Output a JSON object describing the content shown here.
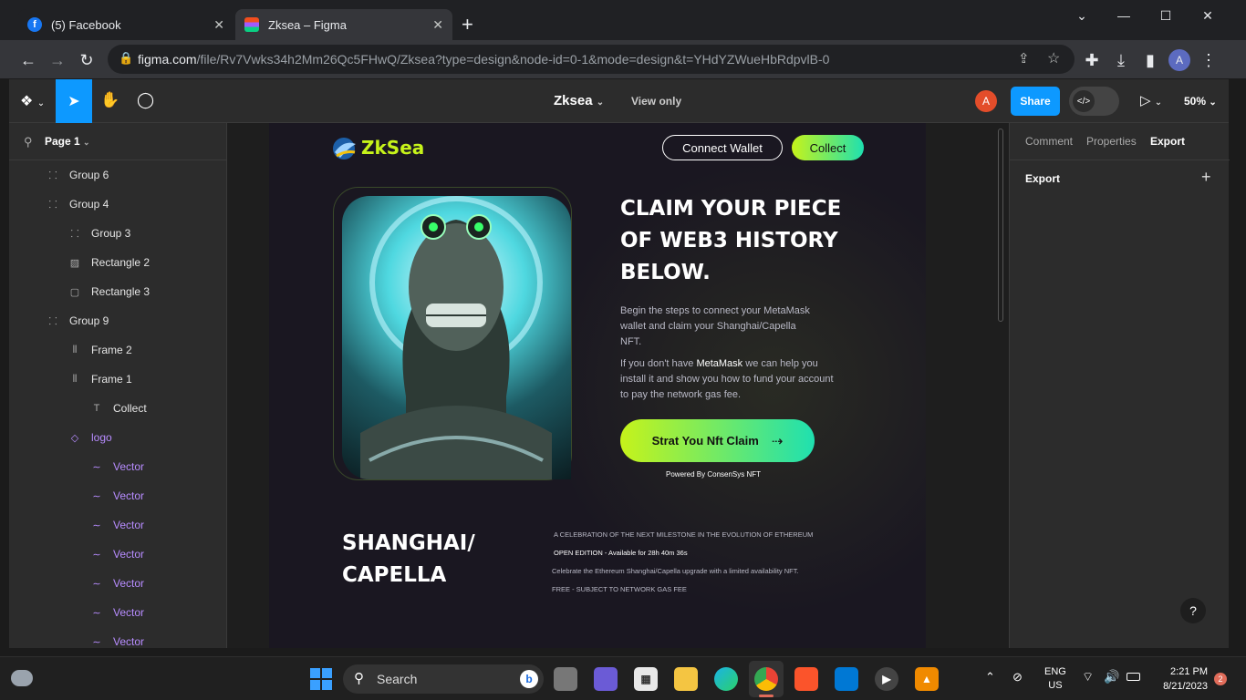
{
  "browser": {
    "tabs": [
      {
        "title": "(5) Facebook",
        "icon": "facebook-icon",
        "active": false
      },
      {
        "title": "Zksea – Figma",
        "icon": "figma-icon",
        "active": true
      }
    ],
    "new_tab_glyph": "+",
    "url_host": "figma.com",
    "url_path": "/file/Rv7Vwks34h2Mm26Qc5FHwQ/Zksea?type=design&node-id=0-1&mode=design&t=YHdYZWueHbRdpvlB-0",
    "profile_initial": "A"
  },
  "figma": {
    "file_name": "Zksea",
    "mode_label": "View only",
    "user_initial": "A",
    "share_label": "Share",
    "zoom": "50%",
    "page_label": "Page 1",
    "layers": [
      {
        "label": "Group 6",
        "icon": "group",
        "indent": 0
      },
      {
        "label": "Group 4",
        "icon": "group",
        "indent": 0
      },
      {
        "label": "Group 3",
        "icon": "group",
        "indent": 1
      },
      {
        "label": "Rectangle 2",
        "icon": "image",
        "indent": 1
      },
      {
        "label": "Rectangle 3",
        "icon": "rect",
        "indent": 1
      },
      {
        "label": "Group 9",
        "icon": "group",
        "indent": 0
      },
      {
        "label": "Frame 2",
        "icon": "frame",
        "indent": 1
      },
      {
        "label": "Frame 1",
        "icon": "frame",
        "indent": 1
      },
      {
        "label": "Collect",
        "icon": "text",
        "indent": 2
      },
      {
        "label": "logo",
        "icon": "component",
        "indent": 1,
        "purple": true
      },
      {
        "label": "Vector",
        "icon": "vector",
        "indent": 2,
        "purple": true
      },
      {
        "label": "Vector",
        "icon": "vector",
        "indent": 2,
        "purple": true
      },
      {
        "label": "Vector",
        "icon": "vector",
        "indent": 2,
        "purple": true
      },
      {
        "label": "Vector",
        "icon": "vector",
        "indent": 2,
        "purple": true
      },
      {
        "label": "Vector",
        "icon": "vector",
        "indent": 2,
        "purple": true
      },
      {
        "label": "Vector",
        "icon": "vector",
        "indent": 2,
        "purple": true
      },
      {
        "label": "Vector",
        "icon": "vector",
        "indent": 2,
        "purple": true
      }
    ],
    "right_tabs": [
      "Comment",
      "Properties",
      "Export"
    ],
    "active_right_tab": "Export",
    "export_section": "Export",
    "help_glyph": "?"
  },
  "design": {
    "logo_text": "ZkSea",
    "connect_wallet": "Connect Wallet",
    "collect": "Collect",
    "hero_title_1": "CLAIM YOUR PIECE",
    "hero_title_2": "OF WEB3 HISTORY",
    "hero_title_3": "BELOW.",
    "para1_1": "Begin the steps to connect your MetaMask",
    "para1_2": "wallet and claim your Shanghai/Capella",
    "para1_3": "NFT.",
    "para2_1a": "If you don't have ",
    "para2_1b": "MetaMask",
    "para2_1c": " we can help you",
    "para2_2": "install it and show you how to fund your account",
    "para2_3": "to pay the network gas fee.",
    "cta": "Strat You Nft Claim",
    "powered": "Powered By ConsenSys NFT",
    "section_title_1": "SHANGHAI/",
    "section_title_2": "CAPELLA",
    "info_1": "A CELEBRATION OF THE NEXT MILESTONE IN THE EVOLUTION OF ETHEREUM",
    "info_2": "OPEN EDITION - Available for 28h 40m 36s",
    "info_3": "Celebrate the Ethereum Shanghai/Capella upgrade with a limited availability NFT.",
    "info_4": "FREE - SUBJECT TO NETWORK GAS FEE",
    "accent_green": "#c6f31a",
    "accent_teal": "#1fe0b0"
  },
  "taskbar": {
    "search_label": "Search",
    "lang_1": "ENG",
    "lang_2": "US",
    "time": "2:21 PM",
    "date": "8/21/2023",
    "notif_count": "2"
  }
}
